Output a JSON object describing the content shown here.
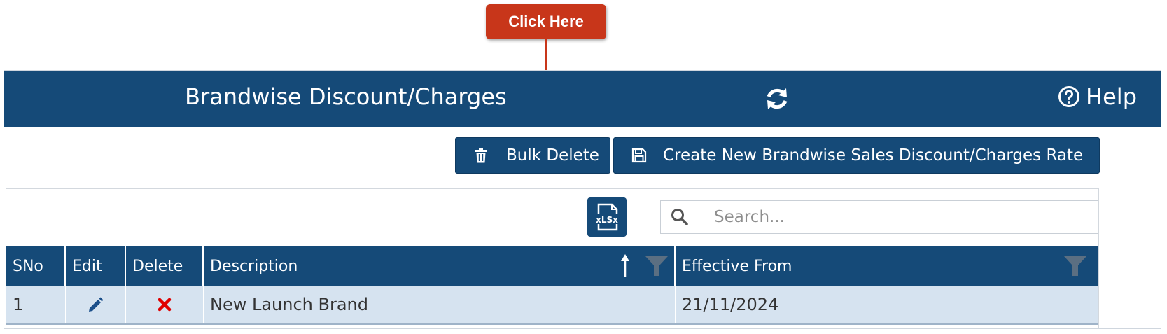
{
  "callout": {
    "label": "Click Here",
    "color": "#c8361a"
  },
  "header": {
    "title": "Brandwise Discount/Charges",
    "help_label": "Help",
    "bg_color": "#154a78"
  },
  "toolbar": {
    "bulk_delete_label": "Bulk Delete",
    "create_label": "Create New Brandwise Sales Discount/Charges Rate"
  },
  "grid": {
    "export_icon": "xlsx-export-icon",
    "search_placeholder": "Search...",
    "columns": [
      "SNo",
      "Edit",
      "Delete",
      "Description",
      "Effective From"
    ],
    "rows": [
      {
        "sno": "1",
        "edit_icon": "pencil-icon",
        "delete_icon": "x-icon",
        "description": "New Launch Brand",
        "effective_from": "21/11/2024"
      }
    ],
    "row_bg": "#d6e3f0",
    "delete_color": "#e00000"
  }
}
